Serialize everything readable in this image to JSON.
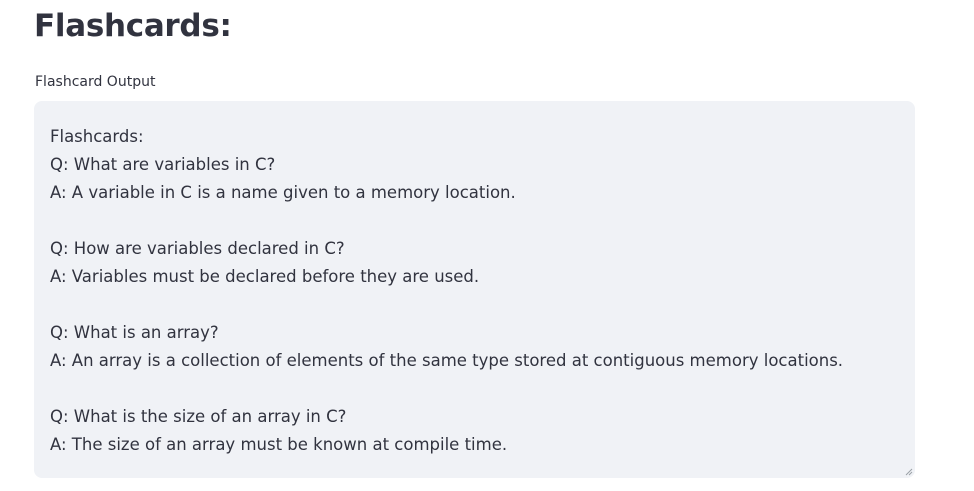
{
  "page": {
    "heading": "Flashcards:",
    "field_label": "Flashcard Output"
  },
  "output": {
    "header": "Flashcards:",
    "cards": [
      {
        "question": "Q: What are variables in C?",
        "answer": "A: A variable in C is a name given to a memory location."
      },
      {
        "question": "Q: How are variables declared in C?",
        "answer": "A: Variables must be declared before they are used."
      },
      {
        "question": "Q: What is an array?",
        "answer": "A: An array is a collection of elements of the same type stored at contiguous memory locations."
      },
      {
        "question": "Q: What is the size of an array in C?",
        "answer": "A: The size of an array must be known at compile time."
      }
    ]
  },
  "colors": {
    "text": "#31333f",
    "textarea_bg": "#f0f2f6"
  },
  "icons": {
    "resize": "resize-handle-icon"
  }
}
